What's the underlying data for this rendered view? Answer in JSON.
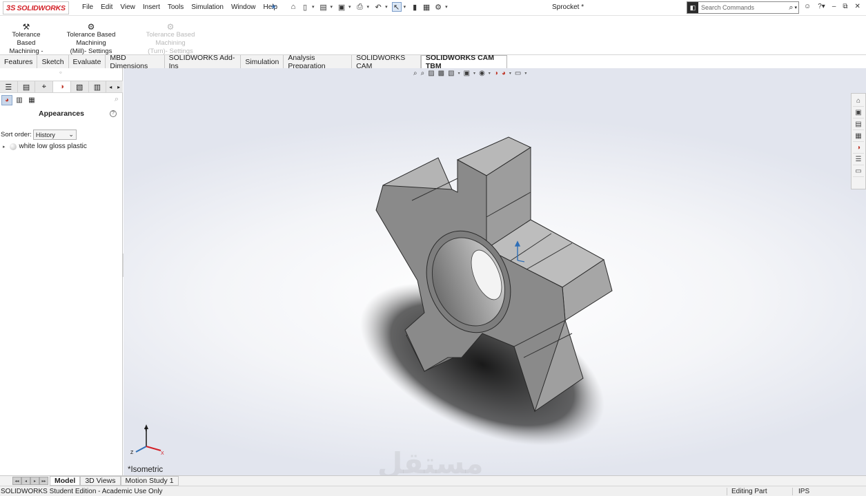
{
  "app": {
    "logo_mark": "3S",
    "logo_text": "SOLIDWORKS",
    "doc_title": "Sprocket *"
  },
  "menu": [
    "File",
    "Edit",
    "View",
    "Insert",
    "Tools",
    "Simulation",
    "Window",
    "Help"
  ],
  "search": {
    "placeholder": "Search Commands"
  },
  "ribbon": {
    "buttons": [
      {
        "line1": "Tolerance Based",
        "line2": "Machining - Run",
        "icon": "machining-run-icon",
        "enabled": true
      },
      {
        "line1": "Tolerance Based Machining",
        "line2": "(Mill)- Settings",
        "icon": "gear-icon",
        "enabled": true
      },
      {
        "line1": "Tolerance Based Machining",
        "line2": "(Turn)- Settings",
        "icon": "gear-icon",
        "enabled": false
      }
    ]
  },
  "tabs": [
    "Features",
    "Sketch",
    "Evaluate",
    "MBD Dimensions",
    "SOLIDWORKS Add-Ins",
    "Simulation",
    "Analysis Preparation",
    "SOLIDWORKS CAM",
    "SOLIDWORKS CAM TBM"
  ],
  "active_tab": "SOLIDWORKS CAM TBM",
  "left_panel": {
    "heading": "Appearances",
    "help": "?",
    "sort_label": "Sort order:",
    "sort_value": "History",
    "items": [
      {
        "label": "white low gloss plastic",
        "icon": "appearance-ball-icon"
      }
    ]
  },
  "viewport": {
    "view_label": "*Isometric",
    "model_color": "#8c8c8c",
    "watermark": "مستقل"
  },
  "bottom_tabs": [
    "Model",
    "3D Views",
    "Motion Study 1"
  ],
  "active_bottom_tab": "Model",
  "status": {
    "left": "SOLIDWORKS Student Edition - Academic Use Only",
    "mode": "Editing Part",
    "units": "IPS"
  },
  "colors": {
    "brand": "#d32027",
    "accent": "#2f6fb7"
  }
}
